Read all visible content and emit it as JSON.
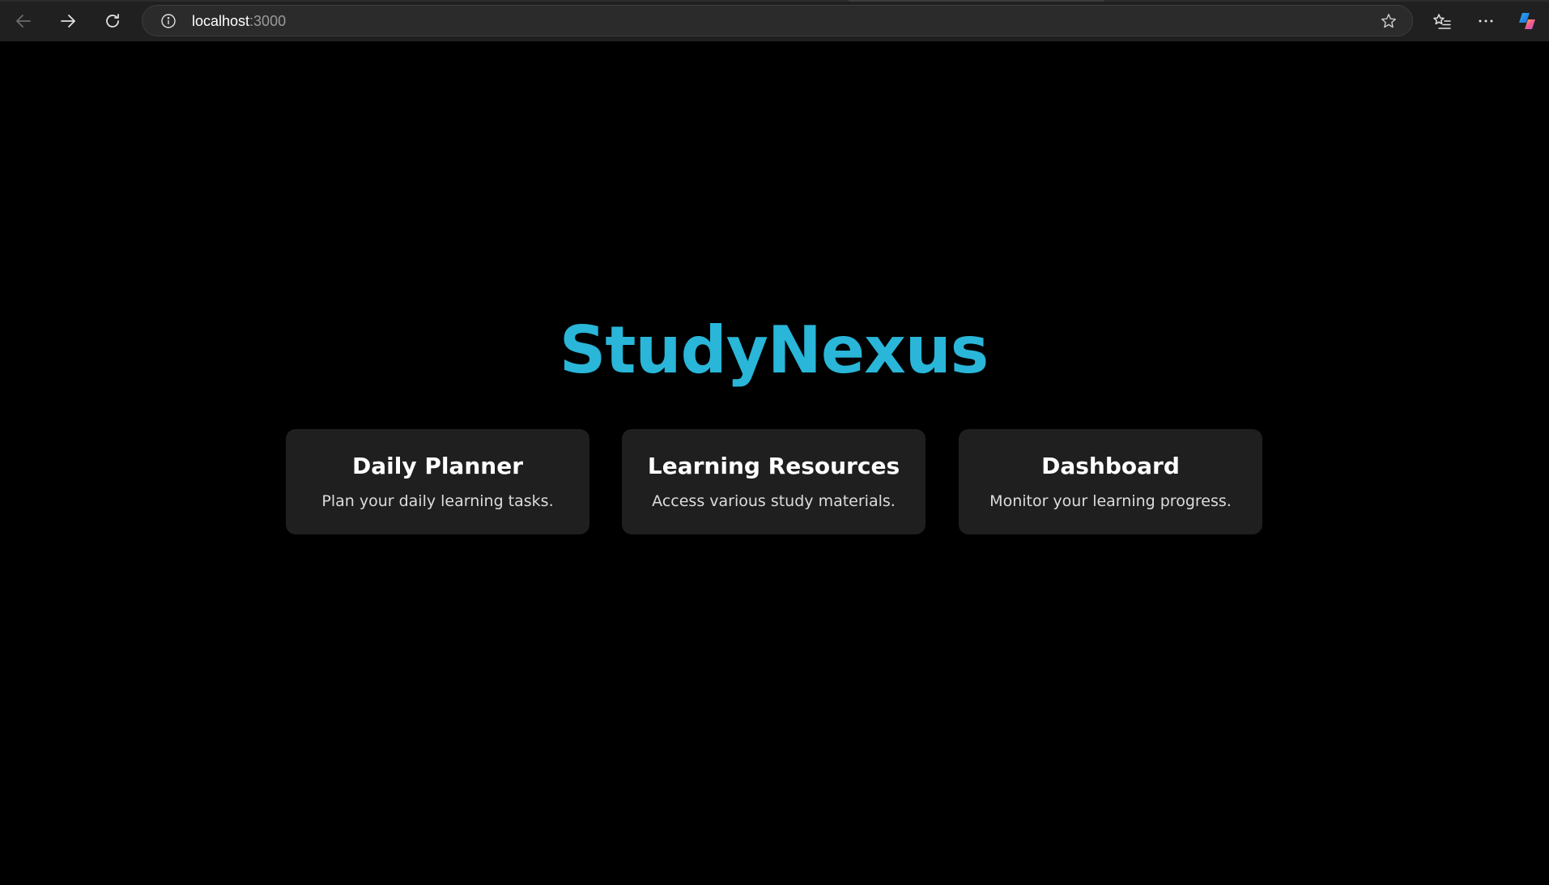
{
  "browser": {
    "url_host": "localhost",
    "url_port": ":3000",
    "back_icon": "arrow-left-icon",
    "forward_icon": "arrow-right-icon",
    "refresh_icon": "refresh-icon",
    "info_icon": "info-icon",
    "favorite_icon": "star-icon",
    "favorites_icon": "favorites-list-icon",
    "more_icon": "ellipsis-icon",
    "copilot_icon": "copilot-icon"
  },
  "app": {
    "title": "StudyNexus",
    "accent_color": "#29b6d8"
  },
  "cards": [
    {
      "title": "Daily Planner",
      "description": "Plan your daily learning tasks."
    },
    {
      "title": "Learning Resources",
      "description": "Access various study materials."
    },
    {
      "title": "Dashboard",
      "description": "Monitor your learning progress."
    }
  ]
}
